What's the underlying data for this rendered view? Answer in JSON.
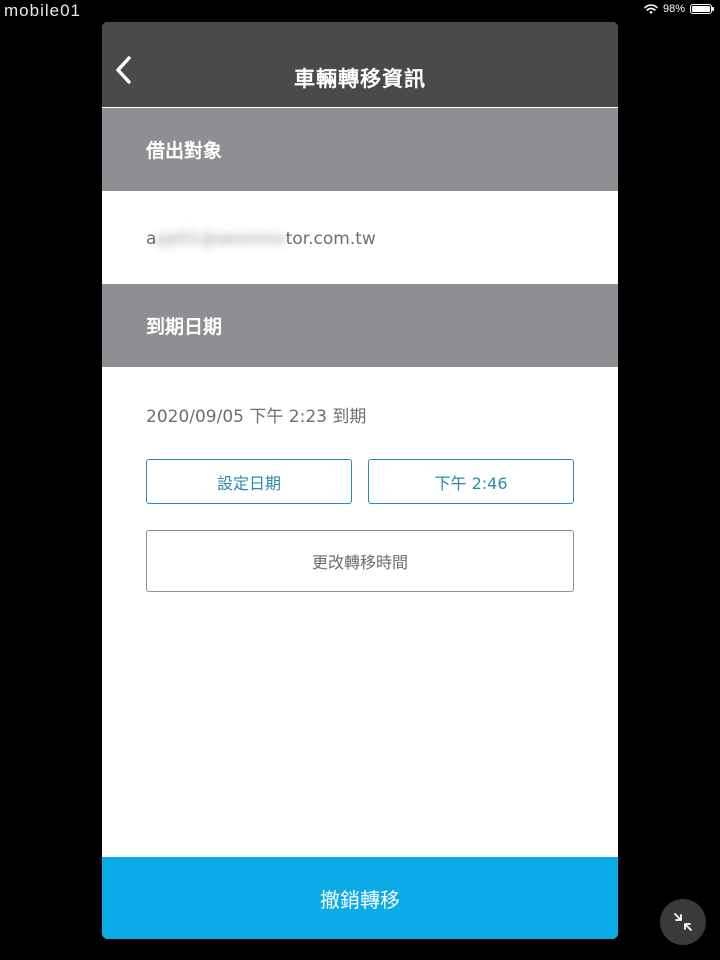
{
  "status_bar": {
    "watermark": "mobile01",
    "battery": "98%",
    "battery_level": 0.98
  },
  "nav": {
    "title": "車輛轉移資訊",
    "back_icon": "chevron-left-icon"
  },
  "borrower": {
    "header": "借出對象",
    "email_start": "a",
    "email_hidden": "pp01@aeonmo",
    "email_end": "tor.com.tw"
  },
  "expiry": {
    "header": "到期日期",
    "text": "2020/09/05 下午 2:23 到期",
    "set_date_label": "設定日期",
    "time_label": "下午 2:46",
    "change_time_label": "更改轉移時間"
  },
  "footer": {
    "cancel_label": "撤銷轉移"
  },
  "floating": {
    "icon": "collapse-arrows-icon"
  },
  "colors": {
    "nav_bg": "#4a4a4a",
    "section_bg": "#8e8e93",
    "accent_blue": "#2a8ab0",
    "primary_button": "#0aabe6"
  }
}
